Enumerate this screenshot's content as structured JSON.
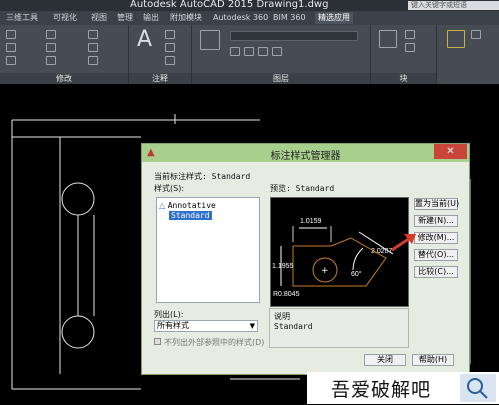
{
  "app": {
    "window_title": "Autodesk AutoCAD 2015    Drawing1.dwg",
    "search_placeholder": "键入关键字或短语"
  },
  "ribbon_tabs": [
    "三维工具",
    "可视化",
    "视图",
    "管理",
    "输出",
    "附加模块",
    "Autodesk 360",
    "BIM 360",
    "精选应用"
  ],
  "ribbon_panels": [
    "修改",
    "注释",
    "图层",
    "块"
  ],
  "ribbon_labels": {
    "text_tool": "A"
  },
  "dialog": {
    "title": "标注样式管理器",
    "current_style_label": "当前标注样式: Standard",
    "styles_label": "样式(S):",
    "styles": [
      {
        "name": "Annotative",
        "selected": false,
        "annotative": true
      },
      {
        "name": "Standard",
        "selected": true,
        "annotative": false
      }
    ],
    "preview_label": "预览: Standard",
    "list_label": "列出(L):",
    "list_value": "所有样式",
    "exclude_xref_label": "不列出外部参照中的样式(D)",
    "description_label": "说明",
    "description_value": "Standard",
    "buttons": {
      "set_current": "置为当前(U)",
      "new": "新建(N)...",
      "modify": "修改(M)...",
      "override": "替代(O)...",
      "compare": "比较(C)...",
      "close": "关闭",
      "help": "帮助(H)"
    },
    "preview_dims": {
      "horizontal": "1.0159",
      "vertical": "1.1955",
      "aligned": "2.0207",
      "angle": "60°",
      "radius": "R0.8045"
    }
  },
  "watermark": {
    "text": "吾爱破解吧"
  },
  "colors": {
    "dialog_title_bg": "#a9cf8d",
    "close_button": "#c9453a",
    "preview_line": "#c97d2a",
    "arrow": "#d63a2a"
  }
}
